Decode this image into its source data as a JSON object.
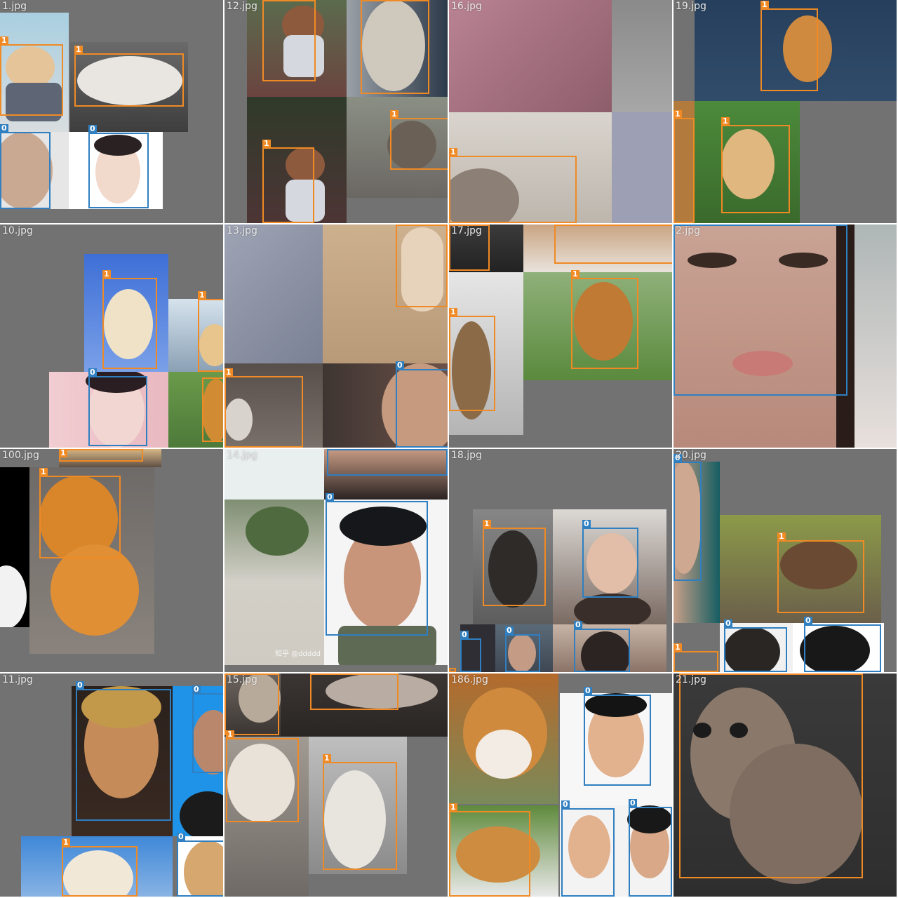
{
  "colors": {
    "class0": "#2f7fc1",
    "class1": "#f08a24",
    "canvas": "#727272"
  },
  "class_labels": {
    "c0": "0",
    "c1": "1"
  },
  "tiles": [
    {
      "title": "1.jpg"
    },
    {
      "title": "12.jpg"
    },
    {
      "title": "16.jpg"
    },
    {
      "title": "19.jpg"
    },
    {
      "title": "10.jpg"
    },
    {
      "title": "13.jpg"
    },
    {
      "title": "17.jpg"
    },
    {
      "title": "2.jpg"
    },
    {
      "title": "100.jpg"
    },
    {
      "title": "14.jpg"
    },
    {
      "title": "18.jpg"
    },
    {
      "title": "20.jpg"
    },
    {
      "title": "11.jpg"
    },
    {
      "title": "15.jpg"
    },
    {
      "title": "186.jpg"
    },
    {
      "title": "21.jpg"
    }
  ],
  "watermark": "知乎 @ddddd"
}
